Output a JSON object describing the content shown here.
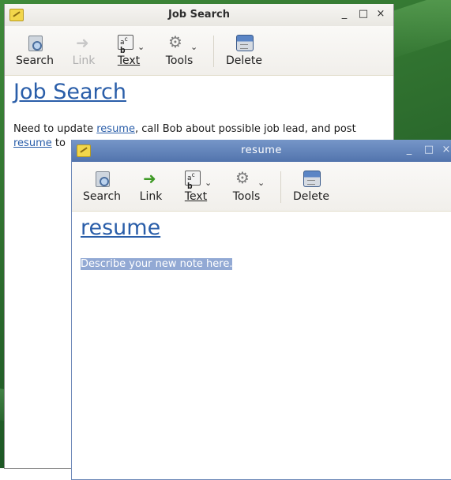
{
  "windows": [
    {
      "title": "Job Search",
      "controls": [
        "_",
        "□",
        "×"
      ],
      "toolbar": {
        "search": "Search",
        "link": "Link",
        "text": "Text",
        "tools": "Tools",
        "delete": "Delete"
      },
      "note": {
        "title": "Job Search",
        "body_prefix": "Need to update ",
        "link1": "resume",
        "body_mid": ", call Bob about possible job lead, and post",
        "link2": "resume",
        "body_after": " to"
      }
    },
    {
      "title": "resume",
      "controls": [
        "_",
        "□",
        "×"
      ],
      "toolbar": {
        "search": "Search",
        "link": "Link",
        "text": "Text",
        "tools": "Tools",
        "delete": "Delete"
      },
      "note": {
        "title": "resume",
        "body": "Describe your new note here."
      }
    }
  ],
  "icons": {
    "app": "note-icon",
    "search": "search-icon",
    "link": "link-arrow-icon",
    "text": "text-style-icon",
    "tools": "gear-icon",
    "delete": "trash-icon"
  },
  "colors": {
    "link": "#2a5ea9",
    "active_titlebar": "#5b7db5",
    "selection": "#92a9d4"
  }
}
